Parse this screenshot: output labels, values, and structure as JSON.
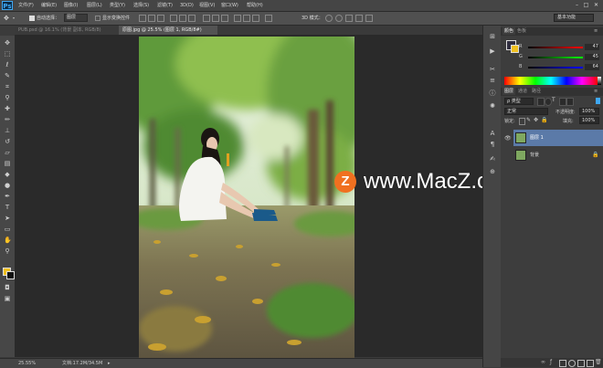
{
  "app": {
    "logo": "Ps"
  },
  "menu": [
    "文件(F)",
    "编辑(E)",
    "图像(I)",
    "图层(L)",
    "类型(Y)",
    "选择(S)",
    "滤镜(T)",
    "3D(D)",
    "视图(V)",
    "窗口(W)",
    "帮助(H)"
  ],
  "window_controls": [
    "–",
    "□",
    "✕"
  ],
  "options_bar": {
    "auto_select_label": "自动选择：",
    "auto_select_value": "图层",
    "show_transform_label": "显示变换控件",
    "mode_3d_label": "3D 模式：",
    "workspace": "基本功能"
  },
  "tabs": [
    {
      "label": "PUB.psd @ 16.1% (背景 副本, RGB/8)",
      "active": false
    },
    {
      "label": "原图.jpg @ 25.5% (图层 1, RGB/8#)",
      "active": true
    }
  ],
  "status": {
    "zoom": "25.55%",
    "doc": "文档:17.2M/34.5M"
  },
  "color_panel": {
    "tabs": [
      "颜色",
      "色板"
    ],
    "sliders": [
      {
        "label": "R",
        "value": "47"
      },
      {
        "label": "G",
        "value": "45"
      },
      {
        "label": "B",
        "value": "64"
      }
    ]
  },
  "layers_panel": {
    "tabs": [
      "图层",
      "通道",
      "路径"
    ],
    "filter_label": "ρ 类型",
    "blend_mode": "正常",
    "opacity_label": "不透明度:",
    "opacity_value": "100%",
    "lock_label": "锁定:",
    "fill_label": "填充:",
    "fill_value": "100%",
    "layers": [
      {
        "name": "图层 1",
        "selected": true,
        "visible": true
      },
      {
        "name": "背景",
        "selected": false,
        "visible": false,
        "locked": true
      }
    ]
  },
  "watermark": {
    "text": "www.MacZ.com",
    "logo_letter": "Z"
  },
  "colors": {
    "accent": "#3fa8f5",
    "selected_layer": "#5b7aa8",
    "watermark_orange": "#f07020"
  }
}
